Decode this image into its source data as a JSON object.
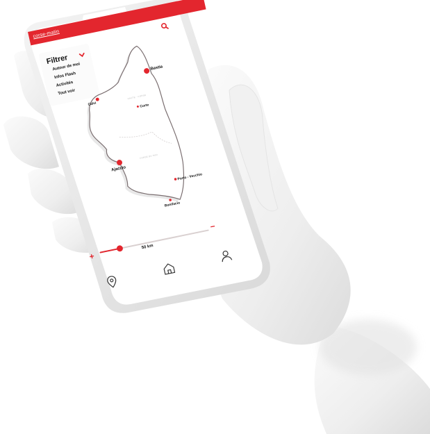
{
  "header": {
    "logo_text": "corse-matin",
    "brand_color": "#e3262e"
  },
  "search": {
    "icon": "search-icon"
  },
  "filter": {
    "title": "Filtrer",
    "items": [
      "Autour de moi",
      "Infos Flash",
      "Activités",
      "Tout voir"
    ]
  },
  "map": {
    "cities": {
      "bastia": "Bastia",
      "calvi": "Calvi",
      "corte": "Corte",
      "ajaccio": "Ajaccio",
      "porto_vecchio": "Porto - Vecchio",
      "bonifacio": "Bonifacio"
    },
    "regions": {
      "haute_corse": "HAUTE · CORSE",
      "corse_du_sud": "CORSE DU SUD"
    }
  },
  "slider": {
    "plus": "+",
    "minus": "−",
    "value_label": "50 km",
    "level_fraction": 0.18
  },
  "tabs": {
    "location_icon": "location-pin-icon",
    "home_icon": "home-icon",
    "profile_icon": "user-icon"
  }
}
